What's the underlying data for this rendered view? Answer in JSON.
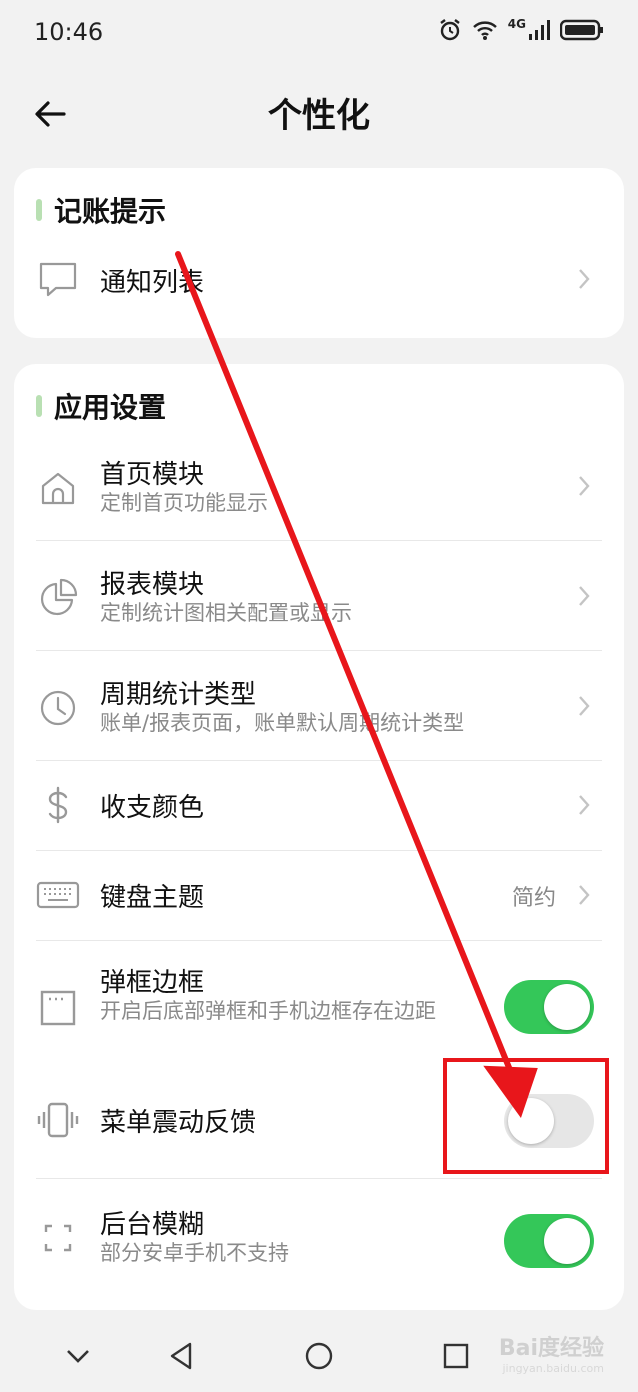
{
  "status_bar": {
    "time": "10:46",
    "network": "4G",
    "icons": [
      "alarm-icon",
      "wifi-icon",
      "signal-icon",
      "battery-icon"
    ]
  },
  "header": {
    "back_icon": "arrow-left-icon",
    "title": "个性化"
  },
  "sections": {
    "reminder": {
      "title": "记账提示",
      "items": [
        {
          "label": "通知列表",
          "icon": "chat-bubble-icon"
        }
      ]
    },
    "app_settings": {
      "title": "应用设置",
      "items": [
        {
          "label": "首页模块",
          "subtitle": "定制首页功能显示",
          "icon": "home-icon"
        },
        {
          "label": "报表模块",
          "subtitle": "定制统计图相关配置或显示",
          "icon": "pie-chart-icon"
        },
        {
          "label": "周期统计类型",
          "subtitle": "账单/报表页面，账单默认周期统计类型",
          "icon": "clock-icon"
        },
        {
          "label": "收支颜色",
          "icon": "dollar-icon"
        },
        {
          "label": "键盘主题",
          "value": "简约",
          "icon": "keyboard-icon"
        },
        {
          "label": "弹框边框",
          "subtitle": "开启后底部弹框和手机边框存在边距",
          "icon": "window-frame-icon",
          "toggle": true
        },
        {
          "label": "菜单震动反馈",
          "icon": "vibration-icon",
          "toggle": false
        },
        {
          "label": "后台模糊",
          "subtitle": "部分安卓手机不支持",
          "icon": "fullscreen-icon",
          "toggle": true
        }
      ]
    }
  },
  "nav": {
    "buttons": [
      "collapse-icon",
      "back-triangle-icon",
      "home-circle-icon",
      "recents-square-icon"
    ]
  },
  "watermark": {
    "text": "Bai度经验",
    "sub": "jingyan.baidu.com"
  },
  "colors": {
    "accent_green": "#34c759",
    "annotation_red": "#e8161b",
    "section_bar": "#b9e0b3"
  }
}
